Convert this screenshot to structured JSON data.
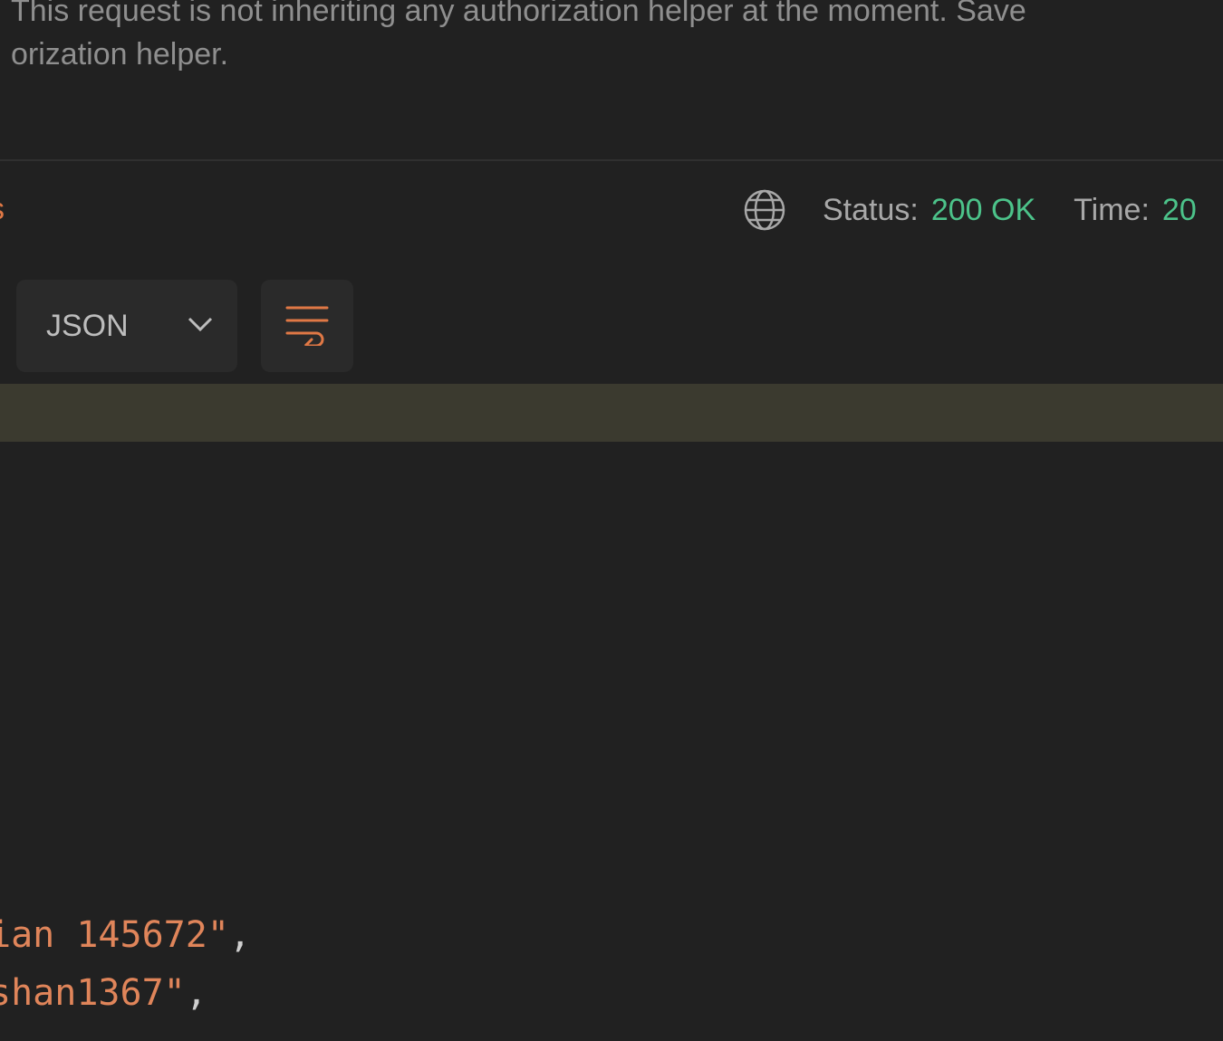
{
  "auth_notice": {
    "line1": "This request is not inheriting any authorization helper at the moment. Save",
    "line2": "orization helper."
  },
  "response": {
    "tab_fragment": "s",
    "status_label": "Status:",
    "status_value": "200 OK",
    "time_label": "Time:",
    "time_value": "20",
    "format": "JSON",
    "icons": [
      "globe-icon",
      "chevron-down-icon",
      "wrap-lines-icon"
    ]
  },
  "code": {
    "lines": [
      {
        "value": "ian 145672\"",
        "punct": ","
      },
      {
        "value": "shan1367\"",
        "punct": ","
      }
    ]
  },
  "colors": {
    "background": "#212121",
    "success": "#4cc38a",
    "accent": "#e07845",
    "highlight": "#3b3a2f"
  }
}
